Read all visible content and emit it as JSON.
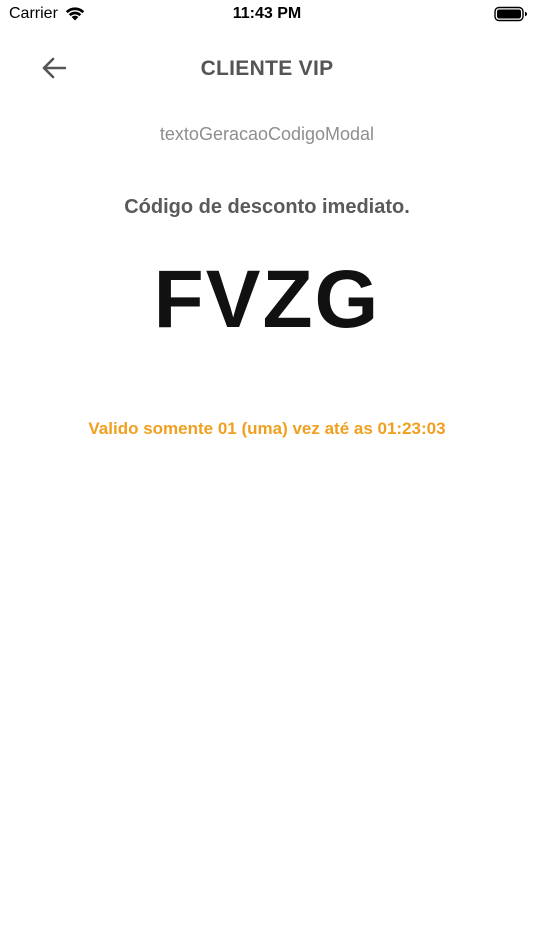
{
  "status_bar": {
    "carrier": "Carrier",
    "time": "11:43 PM",
    "wifi_icon": "wifi-icon",
    "battery_icon": "battery-full-icon"
  },
  "nav": {
    "back_icon": "arrow-left-icon",
    "title": "CLIENTE VIP"
  },
  "content": {
    "subtitle_key": "textoGeracaoCodigoModal",
    "heading": "Código de desconto imediato.",
    "code": "FVZG",
    "validity": "Valido somente 01 (uma) vez até as 01:23:03"
  },
  "colors": {
    "title": "#555555",
    "subtitle": "#8e8e8e",
    "code": "#111111",
    "validity": "#f0a020"
  }
}
